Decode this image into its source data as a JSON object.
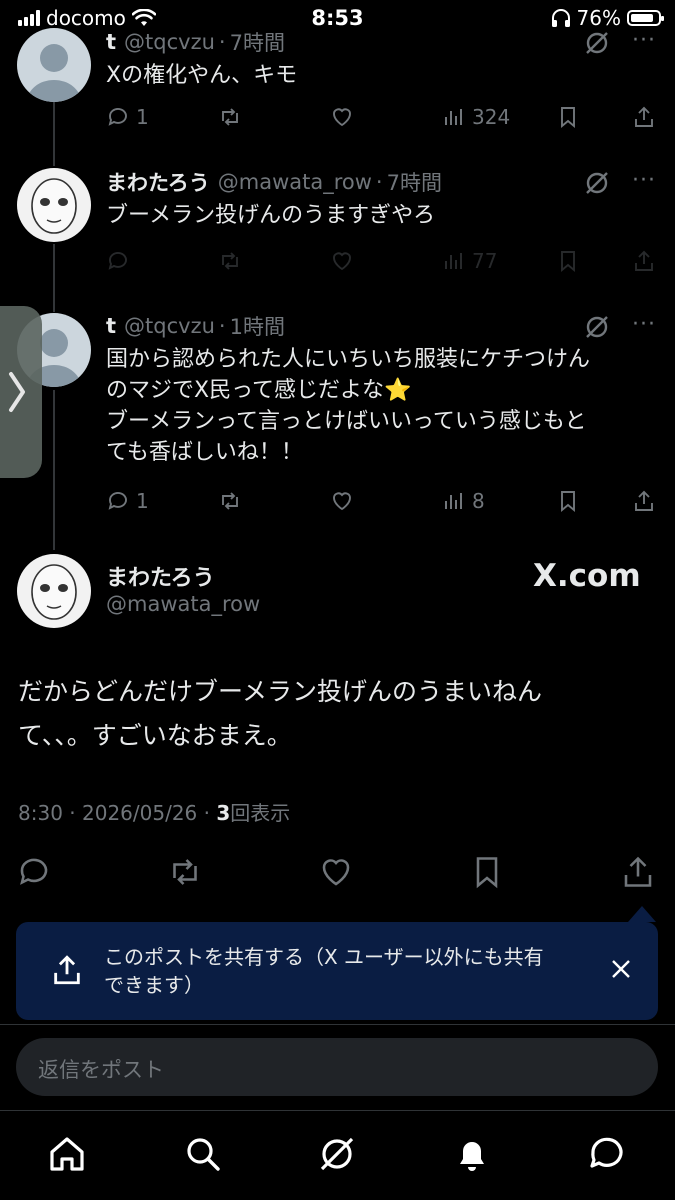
{
  "status_bar": {
    "carrier": "docomo",
    "time": "8:53",
    "battery": "76%"
  },
  "replies": [
    {
      "name": "t",
      "handle": "@tqcvzu",
      "time": "7時間",
      "text": "Xの権化やん、キモ",
      "counts": {
        "reply": "1",
        "repost": "",
        "like": "",
        "views": "324"
      }
    },
    {
      "name": "まわたろう",
      "handle": "@mawata_row",
      "time": "7時間",
      "text": "ブーメラン投げんのうますぎやろ",
      "counts": {
        "reply": "",
        "repost": "",
        "like": "",
        "views": "77"
      }
    },
    {
      "name": "t",
      "handle": "@tqcvzu",
      "time": "1時間",
      "text_lines": [
        "国から認められた人にいちいち服装にケチつけん",
        "のマジでX民って感じだよな⭐",
        "ブーメランって言っとけばいいっていう感じもと",
        "ても香ばしいね！！"
      ],
      "counts": {
        "reply": "1",
        "repost": "",
        "like": "",
        "views": "8"
      }
    }
  ],
  "main_post": {
    "name": "まわたろう",
    "handle": "@mawata_row",
    "watermark": "X.com",
    "text_lines": [
      "だからどんだけブーメラン投げんのうまいねん",
      "て、、。すごいなおまえ。"
    ],
    "time": "8:30",
    "date": "2026/05/26",
    "views_count": "3",
    "views_label": "回表示"
  },
  "toast": {
    "text_lines": [
      "このポストを共有する（X ユーザー以外にも共有",
      "できます）"
    ]
  },
  "reply_box": {
    "placeholder": "返信をポスト"
  },
  "tabs": [
    "home",
    "search",
    "grok",
    "notifications",
    "messages"
  ],
  "icons": [
    "back-chevron-icon",
    "reply-icon",
    "repost-icon",
    "like-icon",
    "views-icon",
    "bookmark-icon",
    "share-icon",
    "grok-icon",
    "more-icon",
    "close-icon"
  ],
  "colors": {
    "background": "#000000",
    "text": "#e7e9ea",
    "secondary": "#71767b",
    "toast": "#0a1d43",
    "divider": "#2f3336"
  }
}
